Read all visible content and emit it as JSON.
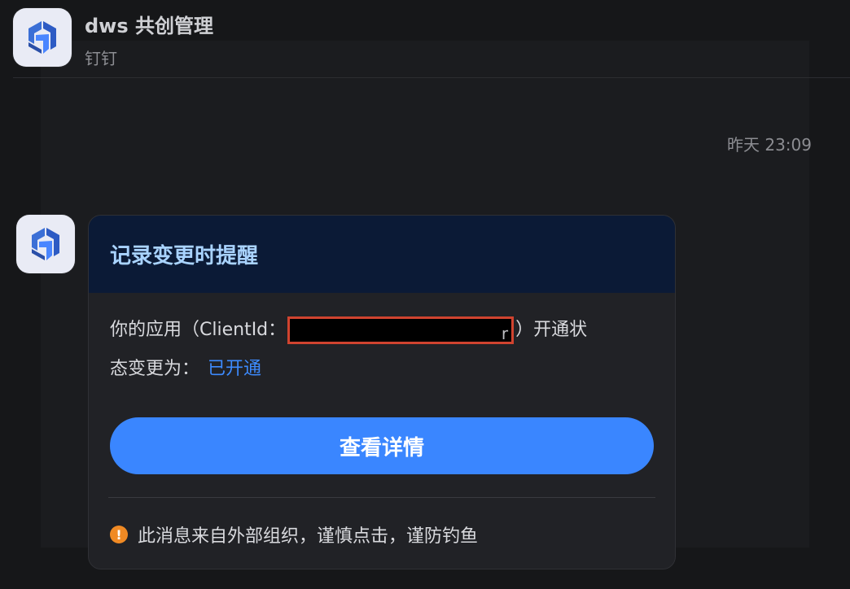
{
  "chat": {
    "title": "dws 共创管理",
    "subtitle": "钉钉",
    "timestamp": "昨天 23:09"
  },
  "icons": {
    "app": "dingtalk-app-logo-icon",
    "warning": "exclamation-warning-icon"
  },
  "colors": {
    "accent": "#3a86ff",
    "link": "#3d8bff",
    "card_header_bg": "#0b1a36",
    "warning": "#f08a24",
    "redaction_border": "#d0432f"
  },
  "card": {
    "title": "记录变更时提醒",
    "body_prefix": "你的应用（ClientId：",
    "redacted_tail": "r",
    "body_suffix": "）开通状",
    "line2_prefix": "态变更为：",
    "status_value": "已开通",
    "button_label": "查看详情",
    "warning_text": "此消息来自外部组织，谨慎点击，谨防钓鱼"
  }
}
